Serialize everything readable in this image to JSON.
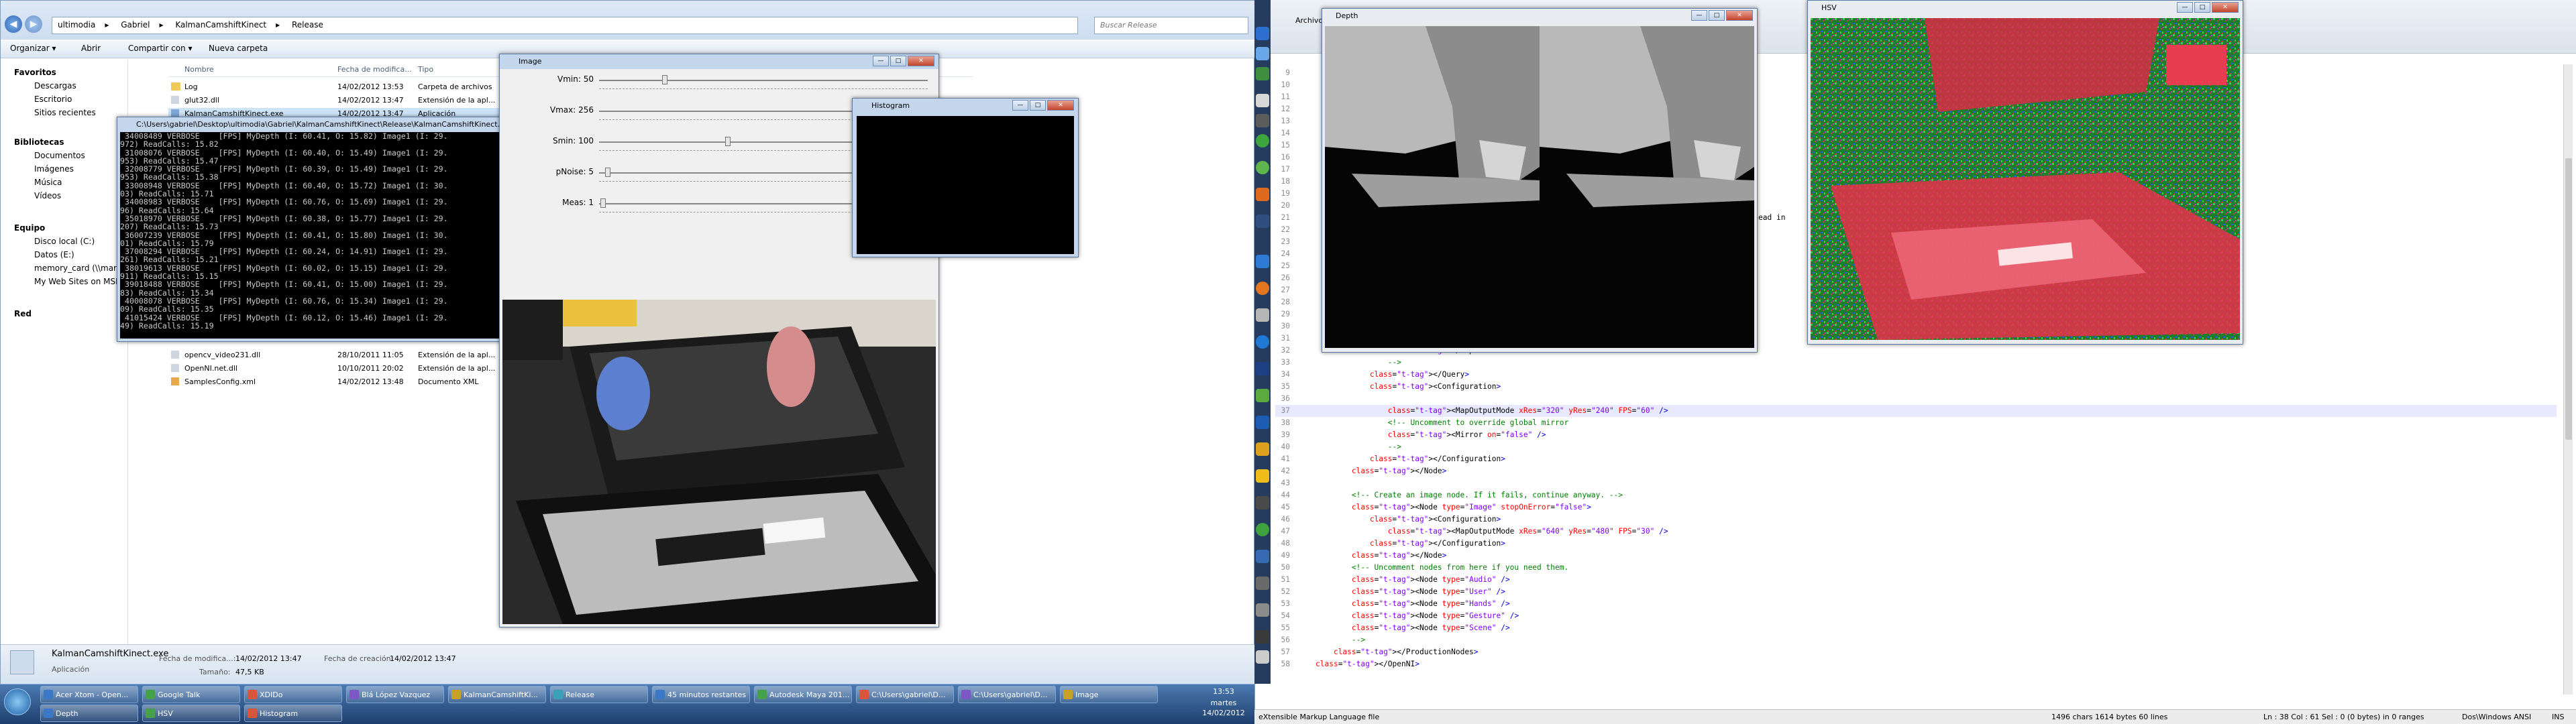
{
  "explorer": {
    "path": [
      "ultimodia",
      "Gabriel",
      "KalmanCamshiftKinect",
      "Release"
    ],
    "search_placeholder": "Buscar Release",
    "toolbar": {
      "organize": "Organizar ▾",
      "open": "Abrir",
      "share": "Compartir con ▾",
      "new_folder": "Nueva carpeta"
    },
    "favorites": {
      "header": "Favoritos",
      "items": [
        "Descargas",
        "Escritorio",
        "Sitios recientes"
      ]
    },
    "libraries": {
      "header": "Bibliotecas",
      "items": [
        "Documentos",
        "Imágenes",
        "Música",
        "Vídeos"
      ]
    },
    "computer": {
      "header": "Equipo",
      "items": [
        "Disco local (C:)",
        "Datos (E:)",
        "memory_card (\\\\marqu...",
        "My Web Sites on MSN"
      ]
    },
    "network": "Red",
    "columns": [
      "Nombre",
      "Fecha de modifica...",
      "Tipo"
    ],
    "files": [
      {
        "name": "Log",
        "date": "14/02/2012 13:53",
        "type": "Carpeta de archivos"
      },
      {
        "name": "glut32.dll",
        "date": "14/02/2012 13:47",
        "type": "Extensión de la apl..."
      },
      {
        "name": "KalmanCamshiftKinect.exe",
        "date": "14/02/2012 13:47",
        "type": "Aplicación"
      },
      {
        "name": "opencv_video231.dll",
        "date": "28/10/2011 11:05",
        "type": "Extensión de la apl..."
      },
      {
        "name": "OpenNI.net.dll",
        "date": "10/10/2011 20:02",
        "type": "Extensión de la apl..."
      },
      {
        "name": "SamplesConfig.xml",
        "date": "14/02/2012 13:48",
        "type": "Documento XML"
      }
    ],
    "details": {
      "filename": "KalmanCamshiftKinect.exe",
      "type": "Aplicación",
      "mod_label": "Fecha de modifica...:",
      "mod_value": "14/02/2012 13:47",
      "size_label": "Tamaño:",
      "size_value": "47,5 KB",
      "created_label": "Fecha de creación:",
      "created_value": "14/02/2012 13:47"
    }
  },
  "console": {
    "title": "C:\\Users\\gabriel\\Desktop\\ultimodia\\Gabriel\\KalmanCamshiftKinect\\Release\\KalmanCamshiftKinect.exe",
    "lines": [
      " 34008489 VERBOSE    [FPS] MyDepth (I: 60.41, O: 15.82) Image1 (I: 29.",
      "972) ReadCalls: 15.82",
      " 31008076 VERBOSE    [FPS] MyDepth (I: 60.40, O: 15.49) Image1 (I: 29.",
      "953) ReadCalls: 15.47",
      " 32008779 VERBOSE    [FPS] MyDepth (I: 60.39, O: 15.49) Image1 (I: 29.",
      "953) ReadCalls: 15.38",
      " 33008948 VERBOSE    [FPS] MyDepth (I: 60.40, O: 15.72) Image1 (I: 30.",
      "03) ReadCalls: 15.71",
      " 34008983 VERBOSE    [FPS] MyDepth (I: 60.76, O: 15.69) Image1 (I: 29.",
      "96) ReadCalls: 15.64",
      " 35018970 VERBOSE    [FPS] MyDepth (I: 60.38, O: 15.77) Image1 (I: 29.",
      "207) ReadCalls: 15.73",
      " 36007239 VERBOSE    [FPS] MyDepth (I: 60.41, O: 15.80) Image1 (I: 30.",
      "01) ReadCalls: 15.79",
      " 37008294 VERBOSE    [FPS] MyDepth (I: 60.24, O: 14.91) Image1 (I: 29.",
      "261) ReadCalls: 15.21",
      " 38019613 VERBOSE    [FPS] MyDepth (I: 60.02, O: 15.15) Image1 (I: 29.",
      "911) ReadCalls: 15.15",
      " 39018488 VERBOSE    [FPS] MyDepth (I: 60.41, O: 15.00) Image1 (I: 29.",
      "83) ReadCalls: 15.34",
      " 40008078 VERBOSE    [FPS] MyDepth (I: 60.76, O: 15.34) Image1 (I: 29.",
      "09) ReadCalls: 15.35",
      " 41015424 VERBOSE    [FPS] MyDepth (I: 60.12, O: 15.46) Image1 (I: 29.",
      "49) ReadCalls: 15.19"
    ]
  },
  "image_window": {
    "title": "Image",
    "sliders": [
      {
        "label": "Vmin: 50",
        "value": 50,
        "max": 256
      },
      {
        "label": "Vmax: 256",
        "value": 256,
        "max": 256
      },
      {
        "label": "Smin: 100",
        "value": 100,
        "max": 256
      },
      {
        "label": "pNoise: 5",
        "value": 5,
        "max": 256
      },
      {
        "label": "Meas: 1",
        "value": 1,
        "max": 256
      }
    ]
  },
  "histogram_window": {
    "title": "Histogram"
  },
  "depth_window": {
    "title": "Depth"
  },
  "hsv_window": {
    "title": "HSV"
  },
  "editor": {
    "tab": "Archivo",
    "lines": [
      {
        "n": "9",
        "html": ""
      },
      {
        "n": "10",
        "html": ""
      },
      {
        "n": "11",
        "html": ""
      },
      {
        "n": "12",
        "html": ""
      },
      {
        "n": "13",
        "html": ""
      },
      {
        "n": "14",
        "html": ""
      },
      {
        "n": "15",
        "html": ""
      },
      {
        "n": "16",
        "html": ""
      },
      {
        "n": "17",
        "html": ""
      },
      {
        "n": "18",
        "html": ""
      },
      {
        "n": "19",
        "html": ""
      },
      {
        "n": "20",
        "html": ""
      },
      {
        "n": "21",
        "html": "                                                                                                ahead in"
      },
      {
        "n": "22",
        "html": ""
      },
      {
        "n": "23",
        "html": ""
      },
      {
        "n": "24",
        "html": ""
      },
      {
        "n": "25",
        "html": ""
      },
      {
        "n": "26",
        "html": ""
      },
      {
        "n": "27",
        "html": ""
      },
      {
        "n": "28",
        "html": ""
      },
      {
        "n": "29",
        "html": ""
      },
      {
        "n": "30",
        "html": ""
      },
      {
        "n": "31",
        "html": ""
      },
      {
        "n": "32",
        "html": "                </Capabilities>"
      },
      {
        "n": "33",
        "html": "                -->"
      },
      {
        "n": "34",
        "html": "            </Query>"
      },
      {
        "n": "35",
        "html": "            <Configuration>"
      },
      {
        "n": "36",
        "html": ""
      },
      {
        "n": "37",
        "html": "                <MapOutputMode xRes=\"320\" yRes=\"240\" FPS=\"60\" />"
      },
      {
        "n": "38",
        "html": "                <!-- Uncomment to override global mirror"
      },
      {
        "n": "39",
        "html": "                <Mirror on=\"false\" />"
      },
      {
        "n": "40",
        "html": "                -->"
      },
      {
        "n": "41",
        "html": "            </Configuration>"
      },
      {
        "n": "42",
        "html": "        </Node>"
      },
      {
        "n": "43",
        "html": ""
      },
      {
        "n": "44",
        "html": "        <!-- Create an image node. If it fails, continue anyway. -->"
      },
      {
        "n": "45",
        "html": "        <Node type=\"Image\" stopOnError=\"false\">"
      },
      {
        "n": "46",
        "html": "            <Configuration>"
      },
      {
        "n": "47",
        "html": "                <MapOutputMode xRes=\"640\" yRes=\"480\" FPS=\"30\" />"
      },
      {
        "n": "48",
        "html": "            </Configuration>"
      },
      {
        "n": "49",
        "html": "        </Node>"
      },
      {
        "n": "50",
        "html": "        <!-- Uncomment nodes from here if you need them."
      },
      {
        "n": "51",
        "html": "        <Node type=\"Audio\" />"
      },
      {
        "n": "52",
        "html": "        <Node type=\"User\" />"
      },
      {
        "n": "53",
        "html": "        <Node type=\"Hands\" />"
      },
      {
        "n": "54",
        "html": "        <Node type=\"Gesture\" />"
      },
      {
        "n": "55",
        "html": "        <Node type=\"Scene\" />"
      },
      {
        "n": "56",
        "html": "        -->"
      },
      {
        "n": "57",
        "html": "    </ProductionNodes>"
      },
      {
        "n": "58",
        "html": "</OpenNI>"
      }
    ],
    "status": {
      "lang": "eXtensible Markup Language file",
      "stats": "1496 chars   1614 bytes   60 lines",
      "pos": "Ln : 38    Col : 61    Sel : 0 (0 bytes) in 0 ranges",
      "eol": "Dos\\Windows  ANSI",
      "ins": "INS"
    }
  },
  "taskbar": {
    "row1": [
      "Acer Xtom - Open...",
      "Google Talk",
      "XDIDo",
      "Blá López Vazquez",
      "KalmanCamshiftKi...",
      "Release",
      "45 minutos restantes",
      "Autodesk Maya 201...",
      "C:\\Users\\gabriel\\D...",
      "C:\\Users\\gabriel\\D...",
      "Image"
    ],
    "row2": [
      "Depth",
      "HSV",
      "Histogram"
    ],
    "clock_time": "13:53",
    "clock_day": "martes",
    "clock_date": "14/02/2012"
  },
  "colors": {
    "accent": "#1e3f6c",
    "console_bg": "#000000",
    "hsv_red": "#e8304a",
    "hsv_green": "#2fae3a"
  }
}
